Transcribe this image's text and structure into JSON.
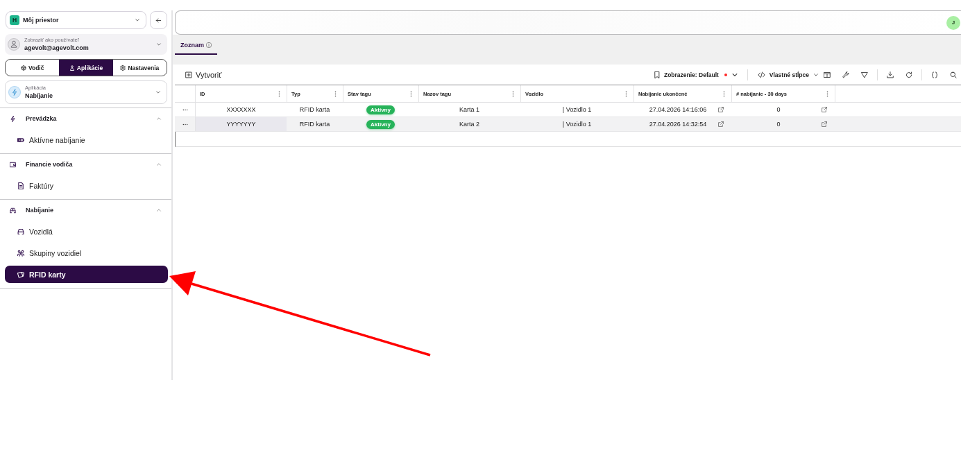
{
  "sidebar": {
    "workspace": {
      "badge": "H",
      "name": "Môj priestor"
    },
    "view_as": {
      "label": "Zobraziť ako používateľ",
      "user": "agevolt@agevolt.com"
    },
    "mode_tabs": [
      {
        "label": "Vodič",
        "kind": "driver",
        "selected": false
      },
      {
        "label": "Aplikácie",
        "kind": "apps",
        "selected": true
      },
      {
        "label": "Nastavenia",
        "kind": "settings",
        "selected": false
      }
    ],
    "app_select": {
      "label": "Aplikácia",
      "value": "Nabíjanie"
    },
    "sections": [
      {
        "label": "Prevádzka",
        "kind": "operations",
        "expanded": true,
        "children": [
          {
            "label": "Aktívne nabíjanie",
            "kind": "sessions",
            "selected": false
          }
        ]
      },
      {
        "label": "Financie vodiča",
        "kind": "finance",
        "expanded": true,
        "children": [
          {
            "label": "Faktúry",
            "kind": "invoices",
            "selected": false
          }
        ]
      },
      {
        "label": "Nabíjanie",
        "kind": "charging",
        "expanded": true,
        "children": [
          {
            "label": "Vozidlá",
            "kind": "vehicles",
            "selected": false
          },
          {
            "label": "Skupiny vozidiel",
            "kind": "groups",
            "selected": false
          },
          {
            "label": "RFID karty",
            "kind": "cards",
            "selected": true
          }
        ]
      }
    ]
  },
  "header": {
    "avatar": "J"
  },
  "tabs": [
    {
      "label": "Zoznam",
      "selected": true
    }
  ],
  "toolbar": {
    "create": "Vytvoriť",
    "view": {
      "label": "Zobrazenie: Default",
      "modified": true
    },
    "custom_columns": "Vlastné stĺpce"
  },
  "table": {
    "columns": [
      {
        "label": "ID",
        "kind": "key"
      },
      {
        "label": "Typ",
        "kind": "text"
      },
      {
        "label": "Stav tagu",
        "kind": "badge"
      },
      {
        "label": "Nazov tagu",
        "kind": "text"
      },
      {
        "label": "Vozidlo",
        "kind": "text"
      },
      {
        "label": "Nabíjanie ukončené",
        "kind": "link"
      },
      {
        "label": "# nabíjanie - 30 days",
        "kind": "link"
      }
    ],
    "rows": [
      {
        "cells": [
          "XXXXXXX",
          "RFID karta",
          "Aktívny",
          "Karta 1",
          "| Vozidlo 1",
          "27.04.2026 14:16:06",
          "0"
        ],
        "hovered": false,
        "focused": false
      },
      {
        "cells": [
          "YYYYYYY",
          "RFID karta",
          "Aktívny",
          "Karta 2",
          "| Vozidlo 1",
          "27.04.2026 14:32:54",
          "0"
        ],
        "hovered": true,
        "focused": true
      }
    ]
  },
  "annotation": {
    "kind": "arrow"
  }
}
